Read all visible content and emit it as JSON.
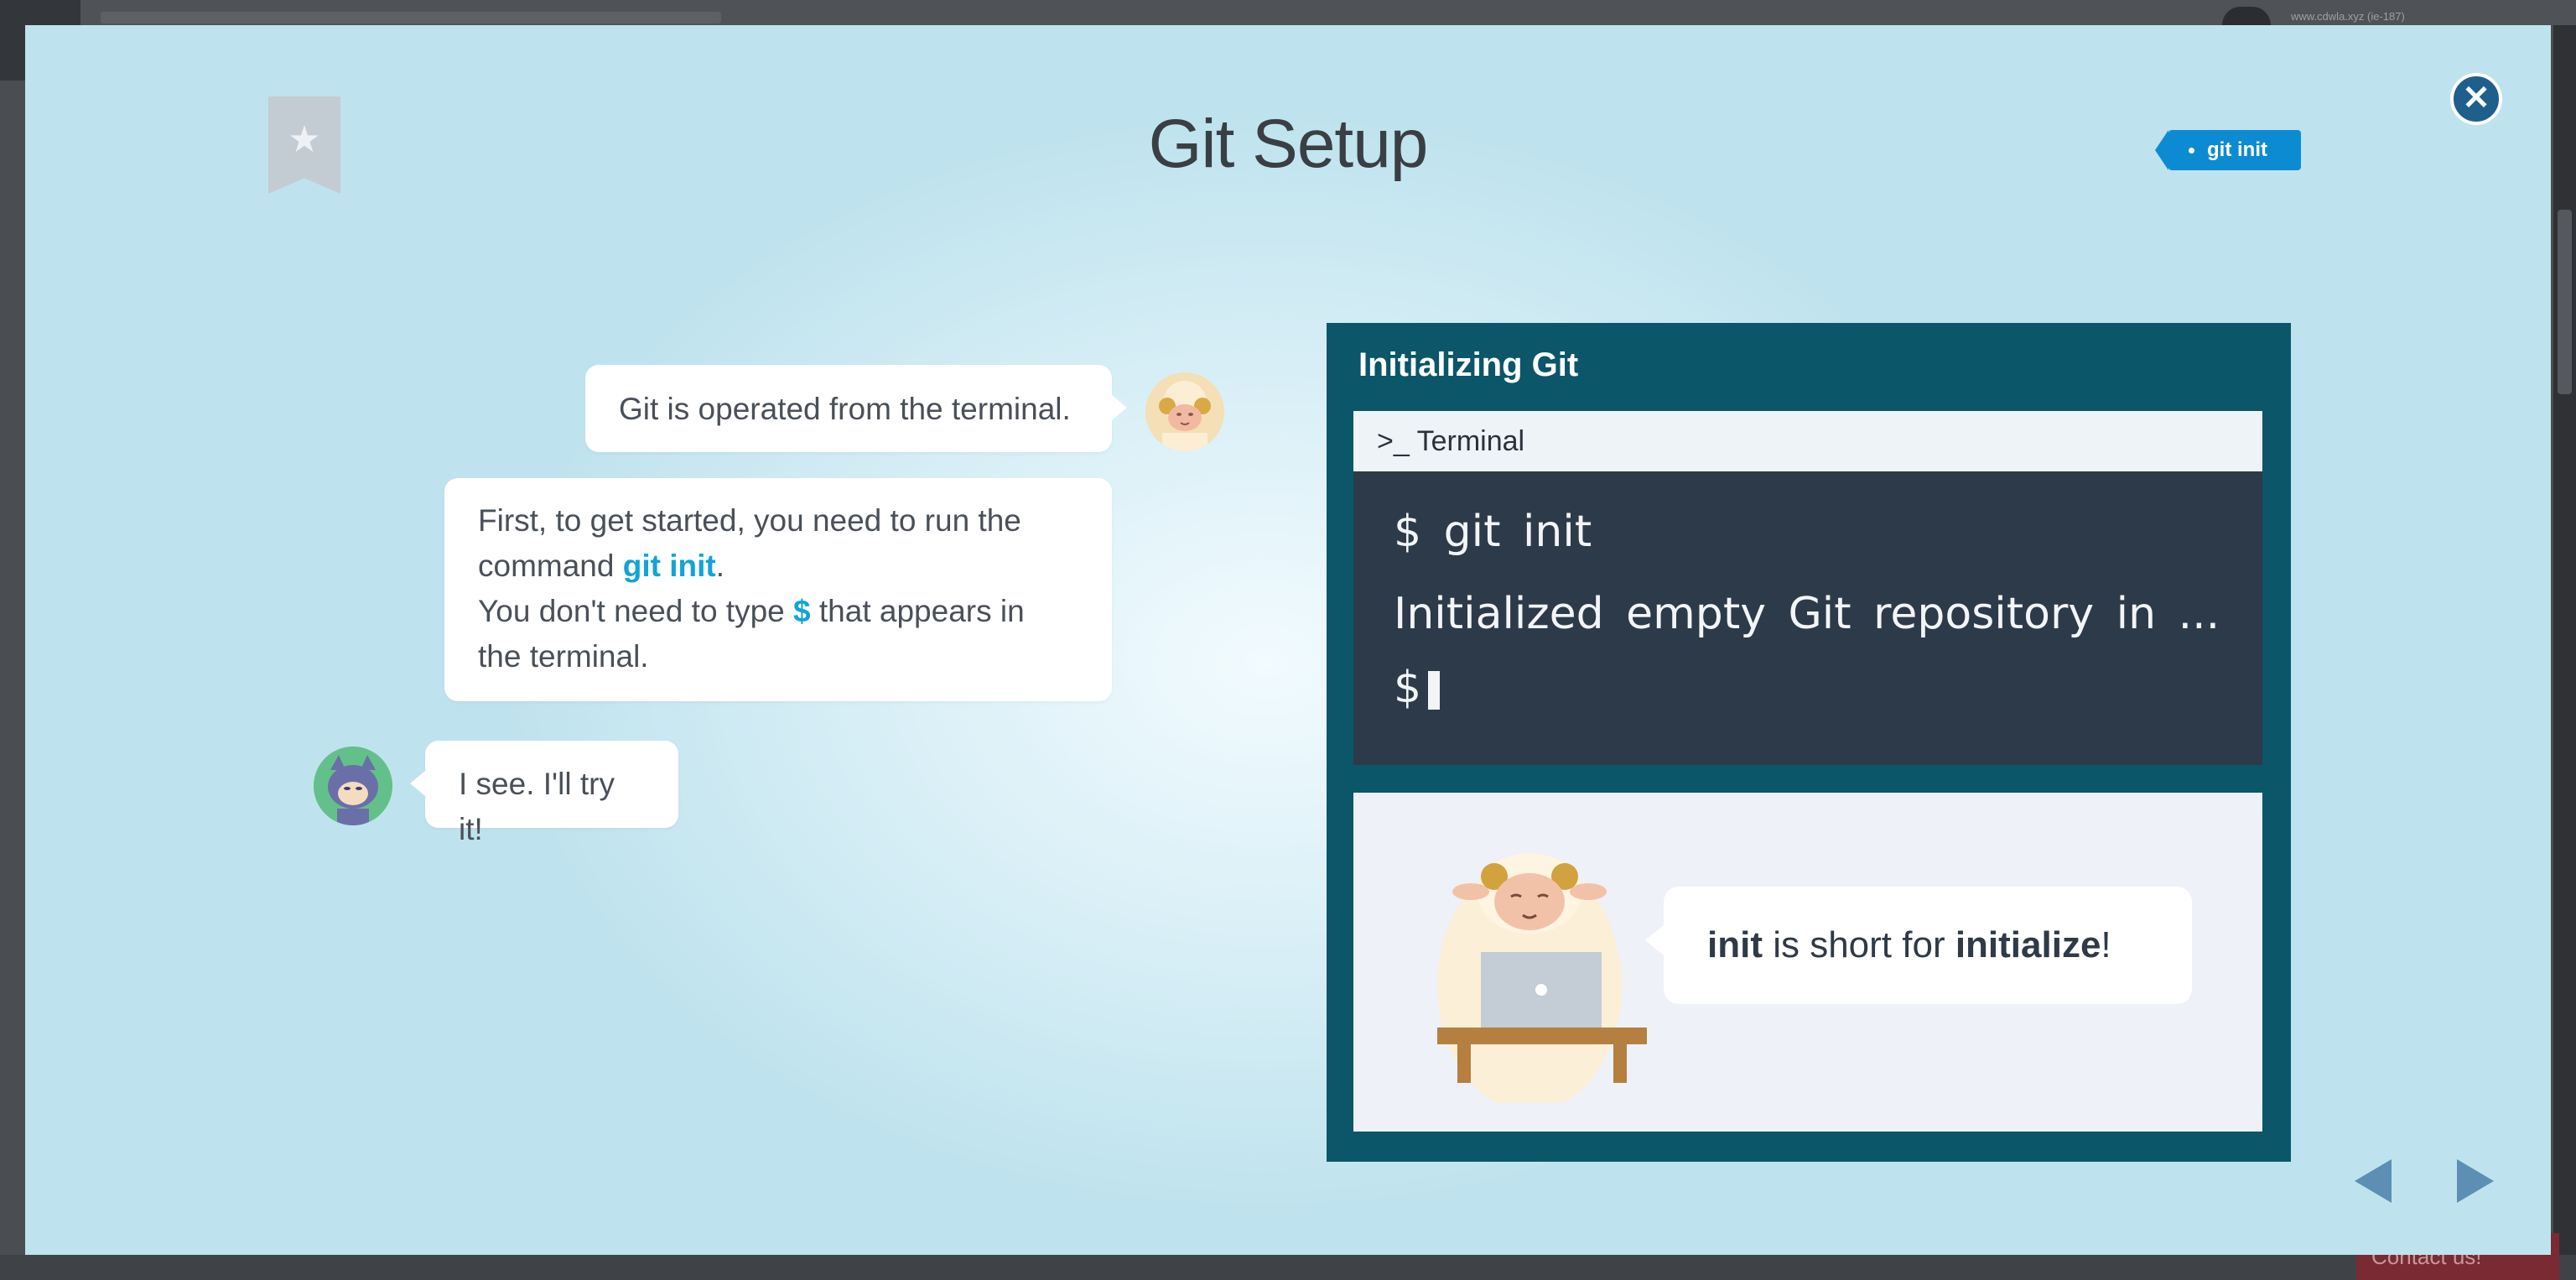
{
  "background": {
    "user_text": "www.cdwla.xyz (ie-187)",
    "contact_label": "Contact us!"
  },
  "lesson": {
    "title": "Git Setup",
    "tag": "git init",
    "close_icon": "close-icon",
    "bookmark_icon": "star-icon"
  },
  "chat": {
    "messages": [
      {
        "speaker": "sheep",
        "text": "Git is operated from the terminal."
      },
      {
        "speaker": "sheep",
        "line1_prefix": "First, to get started, you need to run the",
        "line2_prefix": "command ",
        "command": "git init",
        "line2_suffix": ".",
        "line3_prefix": "You don't need to type ",
        "dollar": "$",
        "line3_suffix": " that appears in",
        "line4": "the terminal."
      },
      {
        "speaker": "user",
        "text": "I see. I'll try it!"
      }
    ]
  },
  "card": {
    "title": "Initializing Git",
    "terminal_label": "Terminal",
    "terminal_prompt_icon": ">_",
    "lines": [
      "$ git init",
      "Initialized empty Git repository in ...",
      "$"
    ],
    "tip_bold1": "init",
    "tip_mid": " is short for ",
    "tip_bold2": "initialize",
    "tip_end": "!"
  },
  "nav": {
    "prev_icon": "triangle-left-icon",
    "next_icon": "triangle-right-icon"
  },
  "colors": {
    "accent": "#12a4d6",
    "tag_bg": "#0d8bd2",
    "card_bg": "#0b5668",
    "terminal_bg": "#2d3a4a"
  }
}
